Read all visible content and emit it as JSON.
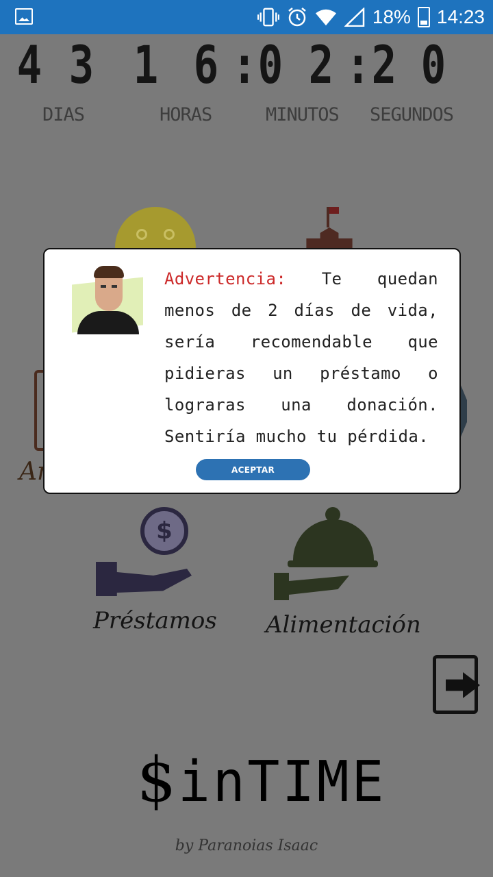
{
  "status_bar": {
    "battery_percent": "18%",
    "time": "14:23",
    "icons": [
      "gallery-icon",
      "vibrate-icon",
      "alarm-icon",
      "wifi-icon",
      "signal-icon",
      "battery-icon"
    ]
  },
  "countdown": {
    "digits": [
      "4",
      "3",
      "1",
      "6",
      ":",
      "0",
      "2",
      ":",
      "2",
      "0"
    ],
    "labels": {
      "days": "DIAS",
      "hours": "HORAS",
      "minutes": "MINUTOS",
      "seconds": "SEGUNDOS"
    }
  },
  "menu": {
    "partial_left_label": "Ar",
    "loans_label": "Préstamos",
    "food_label": "Alimentación"
  },
  "dialog": {
    "warning_label": "Advertencia:",
    "message": " Te quedan menos de 2 días de vida, sería recomendable que pidieras un préstamo o lograras una donación. Sentiría mucho tu pérdida.",
    "accept_label": "ACEPTAR"
  },
  "brand": {
    "dollar": "$",
    "rest": "inTIME",
    "byline": "by Paranoias Isaac"
  },
  "colors": {
    "status_bar": "#1e73be",
    "overlay_background": "#7a7a7a",
    "warning": "#cc2a2a",
    "accept_button": "#2d72b3"
  }
}
